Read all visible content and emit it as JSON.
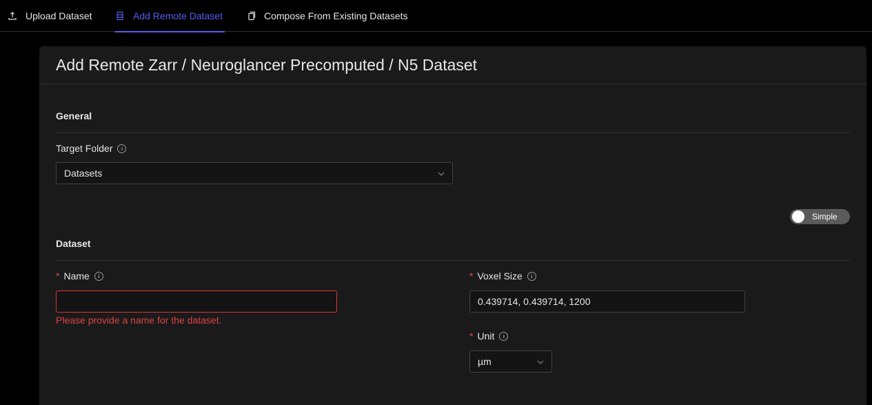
{
  "tabs": [
    {
      "label": "Upload Dataset",
      "icon": "upload-icon"
    },
    {
      "label": "Add Remote Dataset",
      "icon": "database-icon"
    },
    {
      "label": "Compose From Existing Datasets",
      "icon": "copy-icon"
    }
  ],
  "colors": {
    "accent": "#5b5bf0",
    "error": "#dc4446",
    "required": "#e84749"
  },
  "card": {
    "title": "Add Remote Zarr / Neuroglancer Precomputed / N5 Dataset"
  },
  "general": {
    "section_title": "General",
    "target_folder_label": "Target Folder",
    "target_folder_value": "Datasets"
  },
  "mode_switch": {
    "label": "Simple"
  },
  "dataset": {
    "section_title": "Dataset",
    "required_mark": "*",
    "name_label": "Name",
    "name_value": "",
    "name_error": "Please provide a name for the dataset.",
    "voxel_size_label": "Voxel Size",
    "voxel_size_value": "0.439714, 0.439714, 1200",
    "unit_label": "Unit",
    "unit_value": "µm"
  }
}
